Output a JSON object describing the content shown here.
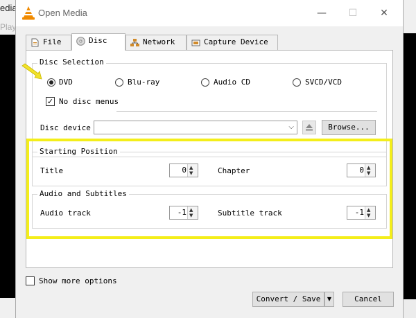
{
  "background": {
    "left_text_1": "edia",
    "left_text_2": "Playb"
  },
  "window": {
    "title": "Open Media",
    "minimize_glyph": "—",
    "maximize_glyph": "☐",
    "close_glyph": "✕"
  },
  "tabs": [
    {
      "label": "File",
      "icon": "file-icon"
    },
    {
      "label": "Disc",
      "icon": "disc-icon"
    },
    {
      "label": "Network",
      "icon": "network-icon"
    },
    {
      "label": "Capture Device",
      "icon": "capture-device-icon"
    }
  ],
  "disc_selection": {
    "label": "Disc Selection",
    "options": [
      "DVD",
      "Blu-ray",
      "Audio CD",
      "SVCD/VCD"
    ],
    "selected": "DVD",
    "no_disc_menus_label": "No disc menus",
    "no_disc_menus_checked": true,
    "device_label": "Disc device",
    "device_value": "",
    "browse_label": "Browse..."
  },
  "starting_position": {
    "label": "Starting Position",
    "title_label": "Title",
    "title_value": "0",
    "chapter_label": "Chapter",
    "chapter_value": "0"
  },
  "audio_subtitles": {
    "label": "Audio and Subtitles",
    "audio_label": "Audio track",
    "audio_value": "-1",
    "subtitle_label": "Subtitle track",
    "subtitle_value": "-1"
  },
  "footer": {
    "show_more_label": "Show more options",
    "show_more_checked": false,
    "convert_label": "Convert / Save",
    "dropdown_glyph": "▼",
    "cancel_label": "Cancel"
  },
  "colors": {
    "highlight": "#f4ee1a",
    "pointer_arrow": "#f2e22a"
  }
}
